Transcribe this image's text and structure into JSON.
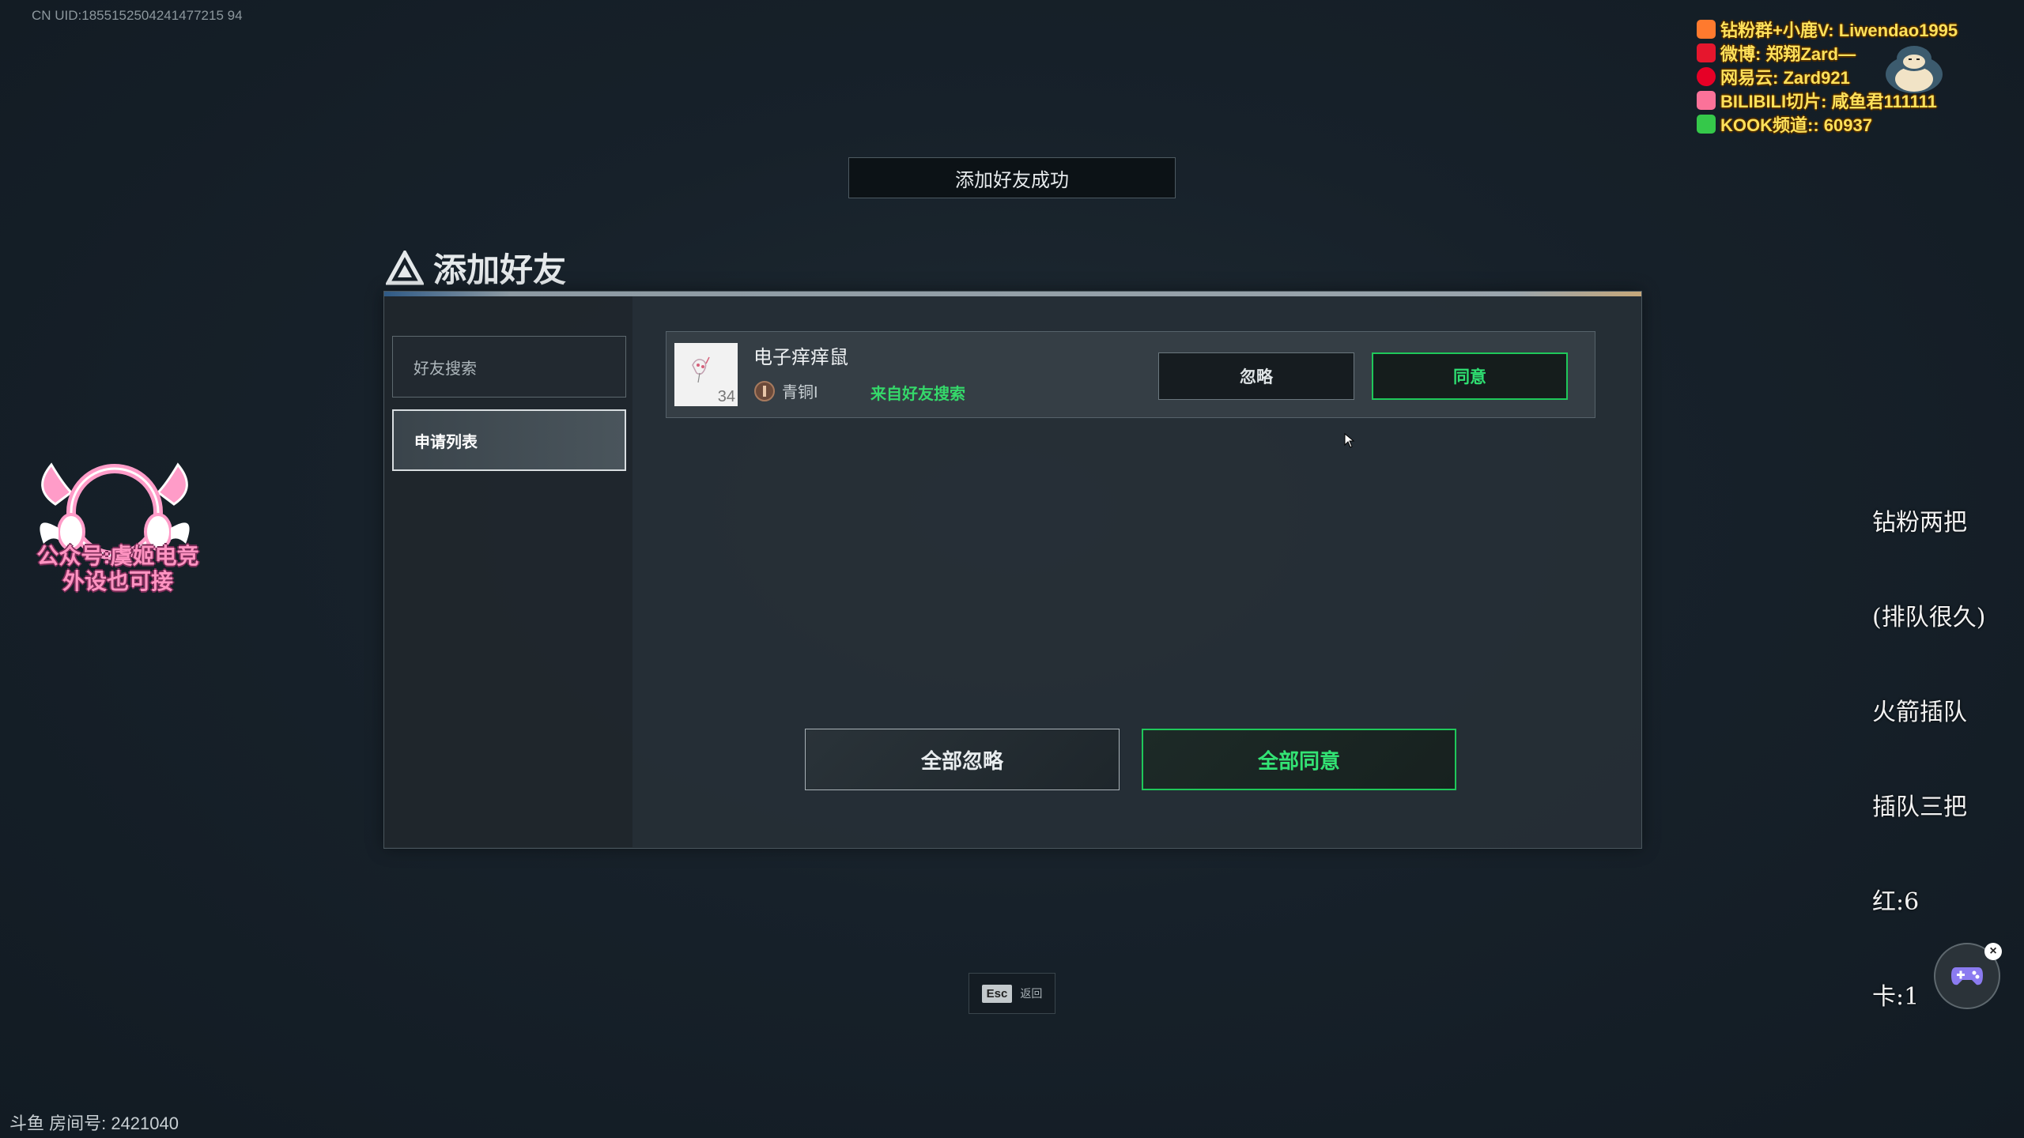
{
  "uid_label": "CN UID:1855152504241477215 94",
  "toast": "添加好友成功",
  "dialog": {
    "title": "添加好友",
    "tabs": [
      {
        "label": "好友搜索",
        "active": false
      },
      {
        "label": "申请列表",
        "active": true
      }
    ],
    "request": {
      "name": "电子痒痒鼠",
      "avatar_level": "34",
      "rank": "青铜I",
      "source": "来自好友搜索",
      "ignore_label": "忽略",
      "agree_label": "同意"
    },
    "ignore_all_label": "全部忽略",
    "agree_all_label": "全部同意"
  },
  "esc": {
    "key": "Esc",
    "label": "返回"
  },
  "social": [
    {
      "icon": "douyu-icon",
      "color": "#ff7a2e",
      "text": "钻粉群+小鹿V: Liwendao1995"
    },
    {
      "icon": "weibo-icon",
      "color": "#e6162d",
      "text": "微博: 郑翔Zard—"
    },
    {
      "icon": "netease-music-icon",
      "color": "#e60026",
      "text": "网易云: Zard921"
    },
    {
      "icon": "bilibili-icon",
      "color": "#fb7299",
      "text": "BILIBILI切片: 咸鱼君111111"
    },
    {
      "icon": "kook-icon",
      "color": "#35c84a",
      "text": "KOOK频道:: 60937"
    }
  ],
  "notes": [
    "钻粉两把",
    "(排队很久)",
    "火箭插队",
    "插队三把",
    "红:6",
    "卡:1"
  ],
  "stream_logo_text": [
    "公众号:虞姬电竞",
    "外设也可接"
  ],
  "room_label": "斗鱼 房间号: 2421040"
}
